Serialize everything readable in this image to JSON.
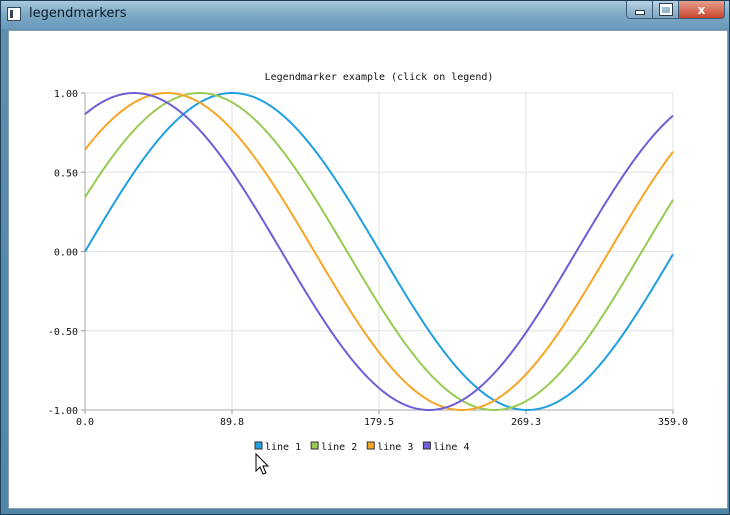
{
  "window": {
    "title": "legendmarkers",
    "minimize_glyph": "",
    "maximize_glyph": "",
    "close_glyph": "x"
  },
  "chart_data": {
    "type": "line",
    "title": "Legendmarker example (click on legend)",
    "xlabel": "",
    "ylabel": "",
    "xlim": [
      0.0,
      359.0
    ],
    "ylim": [
      -1.0,
      1.0
    ],
    "xticks": [
      "0.0",
      "89.8",
      "179.5",
      "269.3",
      "359.0"
    ],
    "yticks": [
      "1.00",
      "0.50",
      "0.00",
      "-0.50",
      "-1.00"
    ],
    "grid": true,
    "legend_position": "bottom",
    "series": [
      {
        "name": "line 1",
        "color": "#209fdf",
        "function": "sin",
        "phase_deg": 0
      },
      {
        "name": "line 2",
        "color": "#99ca53",
        "function": "sin",
        "phase_deg": 20
      },
      {
        "name": "line 3",
        "color": "#f6a625",
        "function": "sin",
        "phase_deg": 40
      },
      {
        "name": "line 4",
        "color": "#6d5fd5",
        "function": "sin",
        "phase_deg": 60
      }
    ]
  }
}
